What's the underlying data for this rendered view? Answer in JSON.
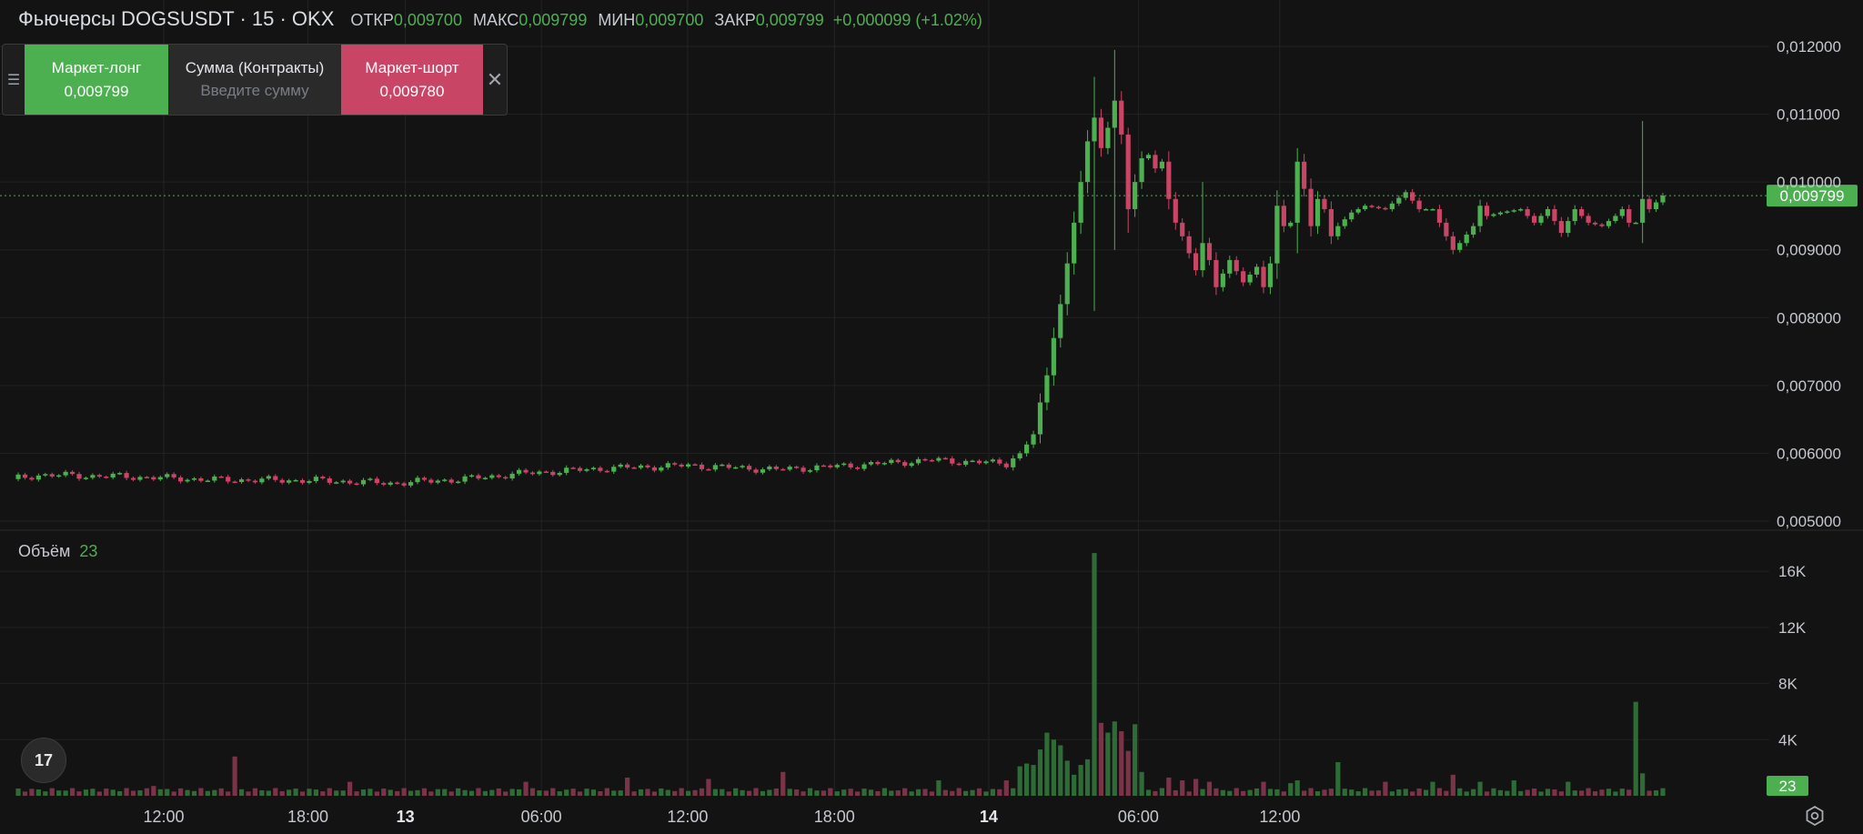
{
  "header": {
    "title": "Фьючерсы DOGSUSDT · 15 · OKX",
    "open_label": "ОТКР",
    "open_value": "0,009700",
    "high_label": "МАКС",
    "high_value": "0,009799",
    "low_label": "МИН",
    "low_value": "0,009700",
    "close_label": "ЗАКР",
    "close_value": "0,009799",
    "change": "+0,000099 (+1.02%)"
  },
  "trade_panel": {
    "long_label": "Маркет-лонг",
    "long_price": "0,009799",
    "amount_label": "Сумма (Контракты)",
    "amount_placeholder": "Введите сумму",
    "short_label": "Маркет-шорт",
    "short_price": "0,009780"
  },
  "volume_legend": {
    "name": "Объём",
    "value": "23"
  },
  "icons": {
    "drag": "drag-handle-icon",
    "close": "close-icon",
    "logo": "tradingview-logo-icon",
    "settings": "settings-gear-icon"
  },
  "colors": {
    "background": "#131313",
    "up": "#4caf50",
    "down": "#c84566",
    "vol_up": "#2f6b37",
    "vol_down": "#7a3448",
    "grid": "#232323",
    "price_line": "#4caf50"
  },
  "chart_data": [
    {
      "type": "candlestick",
      "price_axis": {
        "ylim": [
          0.005,
          0.012
        ],
        "tick_values": [
          0.005,
          0.006,
          0.007,
          0.008,
          0.009,
          0.01,
          0.011,
          0.012
        ],
        "tick_labels": [
          "0,005000",
          "0,006000",
          "0,007000",
          "0,008000",
          "0,009000",
          "0,010000",
          "0,011000",
          "0,012000"
        ]
      },
      "time_axis": {
        "tick_labels": [
          "12:00",
          "18:00",
          "13",
          "06:00",
          "12:00",
          "18:00",
          "14",
          "06:00",
          "12:00"
        ],
        "bold_ticks": [
          "13",
          "14"
        ]
      },
      "last_price": {
        "value": 0.009799,
        "label": "0,009799"
      },
      "anchors": [
        {
          "t": 0,
          "p": 0.00562
        },
        {
          "t": 4,
          "p": 0.00568
        },
        {
          "t": 16,
          "p": 0.00566
        },
        {
          "t": 30,
          "p": 0.00561
        },
        {
          "t": 45,
          "p": 0.0056
        },
        {
          "t": 56,
          "p": 0.00556
        },
        {
          "t": 67,
          "p": 0.00562
        },
        {
          "t": 75,
          "p": 0.0057
        },
        {
          "t": 88,
          "p": 0.00578
        },
        {
          "t": 100,
          "p": 0.00582
        },
        {
          "t": 113,
          "p": 0.00576
        },
        {
          "t": 124,
          "p": 0.00582
        },
        {
          "t": 136,
          "p": 0.0059
        },
        {
          "t": 147,
          "p": 0.00585
        },
        {
          "t": 149,
          "p": 0.006
        },
        {
          "t": 150,
          "p": 0.00613
        },
        {
          "t": 151,
          "p": 0.00628
        },
        {
          "t": 152,
          "p": 0.00675
        },
        {
          "t": 153,
          "p": 0.00715
        },
        {
          "t": 154,
          "p": 0.0077
        },
        {
          "t": 155,
          "p": 0.0082
        },
        {
          "t": 156,
          "p": 0.0088
        },
        {
          "t": 157,
          "p": 0.0094
        },
        {
          "t": 158,
          "p": 0.01
        },
        {
          "t": 159,
          "p": 0.0106
        },
        {
          "t": 160,
          "p": 0.01095
        },
        {
          "t": 161,
          "p": 0.0105
        },
        {
          "t": 162,
          "p": 0.0108
        },
        {
          "t": 163,
          "p": 0.0112
        },
        {
          "t": 164,
          "p": 0.0107
        },
        {
          "t": 165,
          "p": 0.0096
        },
        {
          "t": 166,
          "p": 0.01
        },
        {
          "t": 167,
          "p": 0.01035
        },
        {
          "t": 168,
          "p": 0.0104
        },
        {
          "t": 169,
          "p": 0.0102
        },
        {
          "t": 170,
          "p": 0.0103
        },
        {
          "t": 171,
          "p": 0.00975
        },
        {
          "t": 172,
          "p": 0.0094
        },
        {
          "t": 173,
          "p": 0.0092
        },
        {
          "t": 175,
          "p": 0.0087
        },
        {
          "t": 176,
          "p": 0.0091
        },
        {
          "t": 177,
          "p": 0.00885
        },
        {
          "t": 178,
          "p": 0.00845
        },
        {
          "t": 180,
          "p": 0.00885
        },
        {
          "t": 182,
          "p": 0.00852
        },
        {
          "t": 184,
          "p": 0.00875
        },
        {
          "t": 185,
          "p": 0.00845
        },
        {
          "t": 186,
          "p": 0.0088
        },
        {
          "t": 187,
          "p": 0.00965
        },
        {
          "t": 188,
          "p": 0.00935
        },
        {
          "t": 189,
          "p": 0.0094
        },
        {
          "t": 190,
          "p": 0.0103
        },
        {
          "t": 191,
          "p": 0.0099
        },
        {
          "t": 192,
          "p": 0.00935
        },
        {
          "t": 193,
          "p": 0.00975
        },
        {
          "t": 194,
          "p": 0.0096
        },
        {
          "t": 195,
          "p": 0.0092
        },
        {
          "t": 196,
          "p": 0.00935
        },
        {
          "t": 198,
          "p": 0.00955
        },
        {
          "t": 200,
          "p": 0.00965
        },
        {
          "t": 203,
          "p": 0.0096
        },
        {
          "t": 206,
          "p": 0.00985
        },
        {
          "t": 208,
          "p": 0.0096
        },
        {
          "t": 210,
          "p": 0.0096
        },
        {
          "t": 212,
          "p": 0.0092
        },
        {
          "t": 213,
          "p": 0.009
        },
        {
          "t": 214,
          "p": 0.0091
        },
        {
          "t": 216,
          "p": 0.00935
        },
        {
          "t": 217,
          "p": 0.00965
        },
        {
          "t": 218,
          "p": 0.0095
        },
        {
          "t": 220,
          "p": 0.00955
        },
        {
          "t": 223,
          "p": 0.0096
        },
        {
          "t": 225,
          "p": 0.0094
        },
        {
          "t": 227,
          "p": 0.0096
        },
        {
          "t": 229,
          "p": 0.00925
        },
        {
          "t": 231,
          "p": 0.0096
        },
        {
          "t": 233,
          "p": 0.0094
        },
        {
          "t": 235,
          "p": 0.00935
        },
        {
          "t": 237,
          "p": 0.0095
        },
        {
          "t": 238,
          "p": 0.0096
        },
        {
          "t": 239,
          "p": 0.0094
        },
        {
          "t": 240,
          "p": 0.0094
        },
        {
          "t": 241,
          "p": 0.00975
        },
        {
          "t": 242,
          "p": 0.0096
        },
        {
          "t": 244,
          "p": 0.0098
        }
      ],
      "spikes": [
        {
          "t": 160,
          "high": 0.01155,
          "low": 0.0081
        },
        {
          "t": 163,
          "high": 0.01195,
          "low": 0.009
        },
        {
          "t": 165,
          "high": 0.0108,
          "low": 0.00925
        },
        {
          "t": 176,
          "high": 0.01,
          "low": 0.0086
        },
        {
          "t": 190,
          "high": 0.0105,
          "low": 0.00895
        },
        {
          "t": 241,
          "high": 0.0109,
          "low": 0.0091
        }
      ]
    },
    {
      "type": "bar",
      "name": "Объём",
      "ylim": [
        0,
        17500
      ],
      "tick_values": [
        4000,
        8000,
        12000,
        16000
      ],
      "tick_labels": [
        "4K",
        "8K",
        "12K",
        "16K"
      ],
      "last_value": {
        "value": 23,
        "label": "23"
      },
      "base": 300,
      "spikes": [
        {
          "t": 21,
          "v": 700
        },
        {
          "t": 33,
          "v": 2800
        },
        {
          "t": 50,
          "v": 1000
        },
        {
          "t": 76,
          "v": 1000
        },
        {
          "t": 91,
          "v": 1300
        },
        {
          "t": 103,
          "v": 1200
        },
        {
          "t": 114,
          "v": 1700
        },
        {
          "t": 137,
          "v": 1100
        },
        {
          "t": 147,
          "v": 1100
        },
        {
          "t": 149,
          "v": 2100
        },
        {
          "t": 150,
          "v": 2300
        },
        {
          "t": 151,
          "v": 2200
        },
        {
          "t": 152,
          "v": 3300
        },
        {
          "t": 153,
          "v": 4500
        },
        {
          "t": 154,
          "v": 4000
        },
        {
          "t": 155,
          "v": 3600
        },
        {
          "t": 156,
          "v": 2500
        },
        {
          "t": 157,
          "v": 1500
        },
        {
          "t": 158,
          "v": 2200
        },
        {
          "t": 159,
          "v": 2600
        },
        {
          "t": 160,
          "v": 17300
        },
        {
          "t": 161,
          "v": 5200
        },
        {
          "t": 162,
          "v": 4500
        },
        {
          "t": 163,
          "v": 5300
        },
        {
          "t": 164,
          "v": 4600
        },
        {
          "t": 165,
          "v": 3200
        },
        {
          "t": 166,
          "v": 5100
        },
        {
          "t": 167,
          "v": 1700
        },
        {
          "t": 171,
          "v": 1300
        },
        {
          "t": 173,
          "v": 1100
        },
        {
          "t": 175,
          "v": 1200
        },
        {
          "t": 177,
          "v": 1000
        },
        {
          "t": 185,
          "v": 1000
        },
        {
          "t": 189,
          "v": 900
        },
        {
          "t": 190,
          "v": 1100
        },
        {
          "t": 196,
          "v": 2400
        },
        {
          "t": 203,
          "v": 1000
        },
        {
          "t": 210,
          "v": 1000
        },
        {
          "t": 213,
          "v": 1500
        },
        {
          "t": 217,
          "v": 1000
        },
        {
          "t": 222,
          "v": 1100
        },
        {
          "t": 230,
          "v": 1000
        },
        {
          "t": 240,
          "v": 6700
        },
        {
          "t": 241,
          "v": 1600
        }
      ]
    }
  ]
}
